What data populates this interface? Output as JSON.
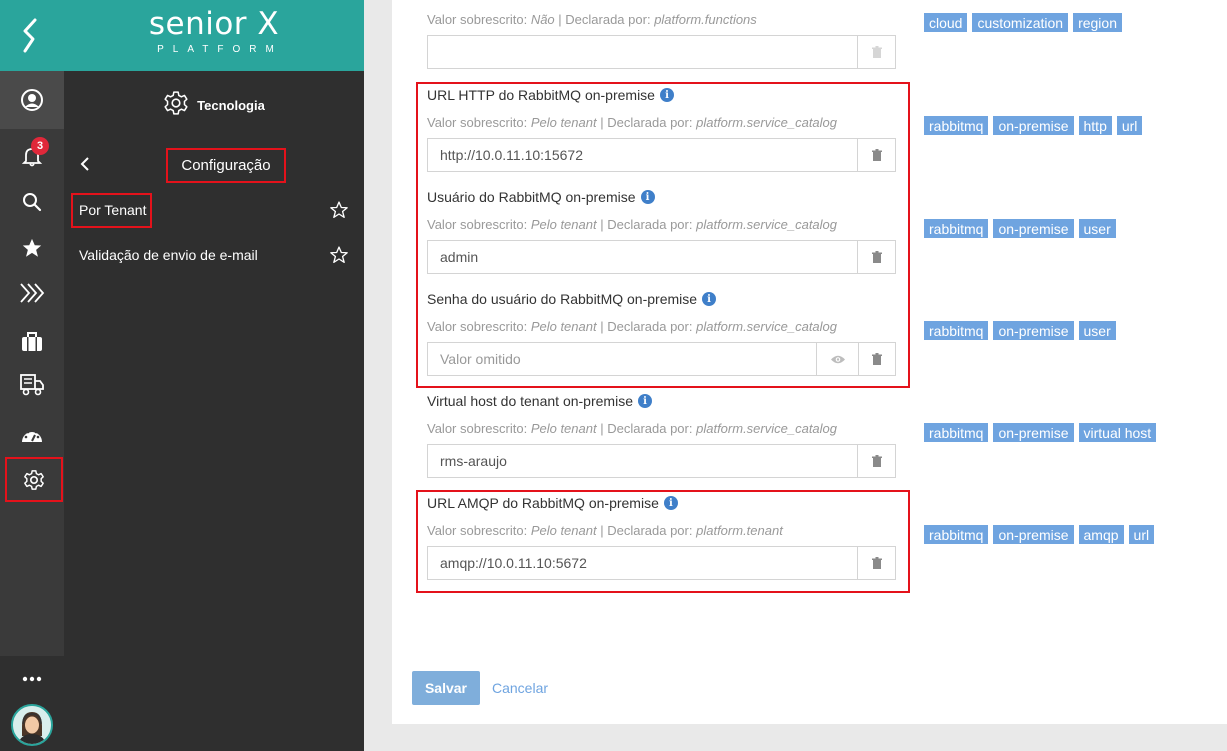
{
  "brand": {
    "name": "senior X",
    "sub": "PLATFORM"
  },
  "rail": {
    "notifications_count": "3"
  },
  "nav": {
    "section": "Tecnologia",
    "current": "Configuração",
    "items": [
      {
        "label": "Por Tenant"
      },
      {
        "label": "Validação de envio de e-mail"
      }
    ]
  },
  "fields": [
    {
      "label": "",
      "meta_prefix": "Valor sobrescrito:",
      "meta_value": "Não",
      "meta_mid": "| Declarada por:",
      "meta_source": "platform.functions",
      "value": "",
      "tags": [
        "cloud",
        "customization",
        "region"
      ]
    },
    {
      "label": "URL HTTP do RabbitMQ on-premise",
      "meta_prefix": "Valor sobrescrito:",
      "meta_value": "Pelo tenant",
      "meta_mid": "| Declarada por:",
      "meta_source": "platform.service_catalog",
      "value": "http://10.0.11.10:15672",
      "tags": [
        "rabbitmq",
        "on-premise",
        "http",
        "url"
      ]
    },
    {
      "label": "Usuário do RabbitMQ on-premise",
      "meta_prefix": "Valor sobrescrito:",
      "meta_value": "Pelo tenant",
      "meta_mid": "| Declarada por:",
      "meta_source": "platform.service_catalog",
      "value": "admin",
      "tags": [
        "rabbitmq",
        "on-premise",
        "user"
      ]
    },
    {
      "label": "Senha do usuário do RabbitMQ on-premise",
      "meta_prefix": "Valor sobrescrito:",
      "meta_value": "Pelo tenant",
      "meta_mid": "| Declarada por:",
      "meta_source": "platform.service_catalog",
      "placeholder": "Valor omitido",
      "tags": [
        "rabbitmq",
        "on-premise",
        "user"
      ]
    },
    {
      "label": "Virtual host do tenant on-premise",
      "meta_prefix": "Valor sobrescrito:",
      "meta_value": "Pelo tenant",
      "meta_mid": "| Declarada por:",
      "meta_source": "platform.service_catalog",
      "value": "rms-araujo",
      "tags": [
        "rabbitmq",
        "on-premise",
        "virtual host"
      ]
    },
    {
      "label": "URL AMQP do RabbitMQ on-premise",
      "meta_prefix": "Valor sobrescrito:",
      "meta_value": "Pelo tenant",
      "meta_mid": "| Declarada por:",
      "meta_source": "platform.tenant",
      "value": "amqp://10.0.11.10:5672",
      "tags": [
        "rabbitmq",
        "on-premise",
        "amqp",
        "url"
      ]
    }
  ],
  "actions": {
    "save": "Salvar",
    "cancel": "Cancelar"
  },
  "colors": {
    "brand": "#2aa59c",
    "highlight": "#e4121b",
    "tag": "#6fa4e0"
  }
}
